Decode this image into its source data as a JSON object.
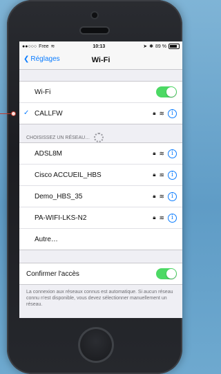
{
  "status_bar": {
    "carrier": "Free",
    "time": "10:13",
    "battery": "89 %"
  },
  "nav": {
    "back_label": "Réglages",
    "title": "Wi-Fi"
  },
  "wifi_toggle": {
    "label": "Wi-Fi",
    "on": true
  },
  "connected_network": {
    "name": "CALLFW"
  },
  "networks_section": {
    "header": "CHOISISSEZ UN RÉSEAU…",
    "items": [
      {
        "name": "ADSL8M"
      },
      {
        "name": "Cisco ACCUEIL_HBS"
      },
      {
        "name": "Demo_HBS_35"
      },
      {
        "name": "PA-WIFI-LKS-N2"
      },
      {
        "name": "Autre…"
      }
    ]
  },
  "confirm_access": {
    "label": "Confirmer l'accès",
    "on": true,
    "note": "La connexion aux réseaux connus est automatique. Si aucun réseau connu n'est disponible, vous devez sélectionner manuellement un réseau."
  },
  "colors": {
    "accent": "#0a7cff",
    "toggle_on": "#4cd964",
    "background": "#efeff4"
  }
}
